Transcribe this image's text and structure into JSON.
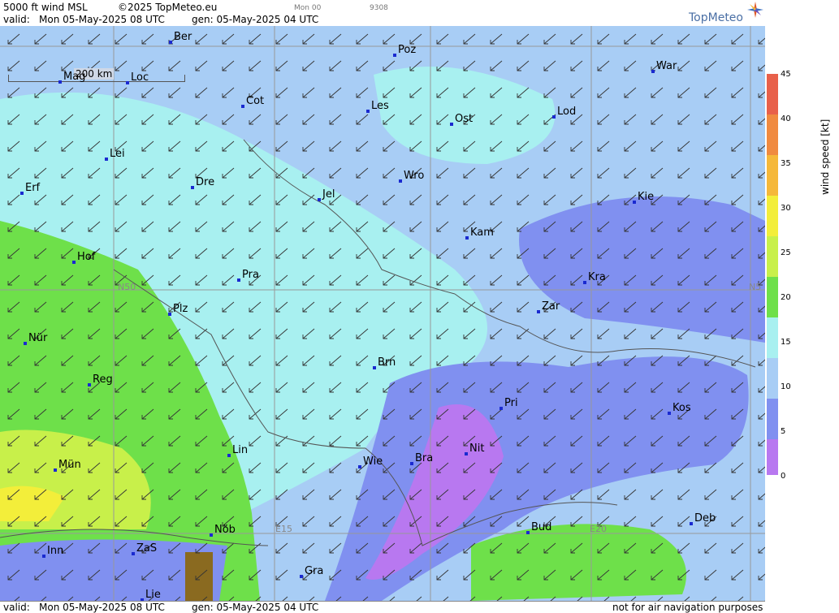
{
  "header": {
    "product": "5000 ft wind MSL",
    "copyright": "©2025 TopMeteo.eu",
    "valid_label": "valid:",
    "valid_time": "Mon  05-May-2025  08 UTC",
    "gen": "gen: 05-May-2025 04 UTC",
    "small_mid": "Mon 00",
    "small_num": "9308",
    "logo": "TopMeteo"
  },
  "footer": {
    "valid_label": "valid:",
    "valid_time": "Mon  05-May-2025  08 UTC",
    "gen": "gen: 05-May-2025 04 UTC",
    "disclaimer": "not for air navigation purposes"
  },
  "legend": {
    "title": "wind speed [kt]",
    "ticks": [
      "45",
      "40",
      "35",
      "30",
      "25",
      "20",
      "15",
      "10",
      "5",
      "0"
    ],
    "colors": [
      "#e8604a",
      "#f08a40",
      "#f5b83a",
      "#f3ee3a",
      "#c8f04a",
      "#6ee04a",
      "#a8f0f0",
      "#a8cdf5",
      "#8090f0",
      "#b878f0"
    ]
  },
  "map": {
    "scale_label": "200 km",
    "grid_labels": [
      "N50",
      "N5",
      "E15",
      "E20"
    ],
    "cities": [
      "Ber",
      "Poz",
      "War",
      "Mag",
      "Loc",
      "Cot",
      "Les",
      "Ost",
      "Lod",
      "Lei",
      "Erf",
      "Dre",
      "Wro",
      "Jel",
      "Kie",
      "Kam",
      "Hof",
      "Pra",
      "Kra",
      "Plz",
      "Zar",
      "Nür",
      "Brn",
      "Reg",
      "Pri",
      "Kos",
      "Lin",
      "Nit",
      "Wie",
      "Bra",
      "Mün",
      "Deb",
      "Nöb",
      "Bud",
      "Inn",
      "ZaS",
      "Gra",
      "Lie"
    ]
  }
}
